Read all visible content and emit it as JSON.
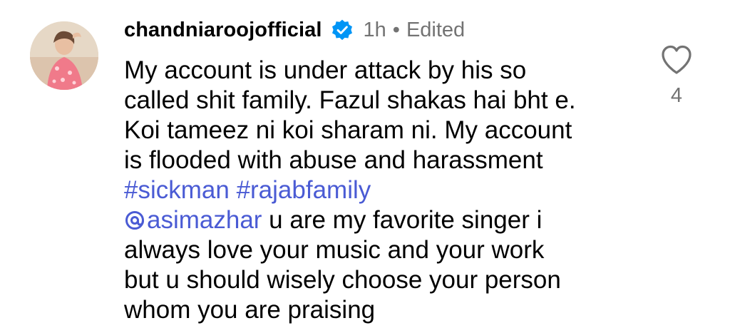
{
  "comment": {
    "username": "chandniaroojofficial",
    "time": "1h",
    "separator": "•",
    "edited": "Edited",
    "text_lines": [
      "My account is under attack by his so",
      "called shit family. Fazul shakas hai bht e.",
      "Koi tameez ni koi sharam ni. My account",
      "is flooded with abuse and harassment"
    ],
    "hashtags": [
      "#sickman",
      "#rajabfamily"
    ],
    "mention": "asimazhar",
    "after_mention": " u are my favorite singer i",
    "text_lines_2": [
      "always love your music and your work",
      "but u should wisely choose your person",
      "whom you are praising"
    ],
    "like_count": "4"
  },
  "icons": {
    "verified": "verified-badge-icon",
    "like": "heart-outline-icon",
    "mention": "threads-at-icon"
  },
  "colors": {
    "link": "#4a5bd4",
    "secondary_text": "#737373",
    "verified": "#0095f6"
  }
}
